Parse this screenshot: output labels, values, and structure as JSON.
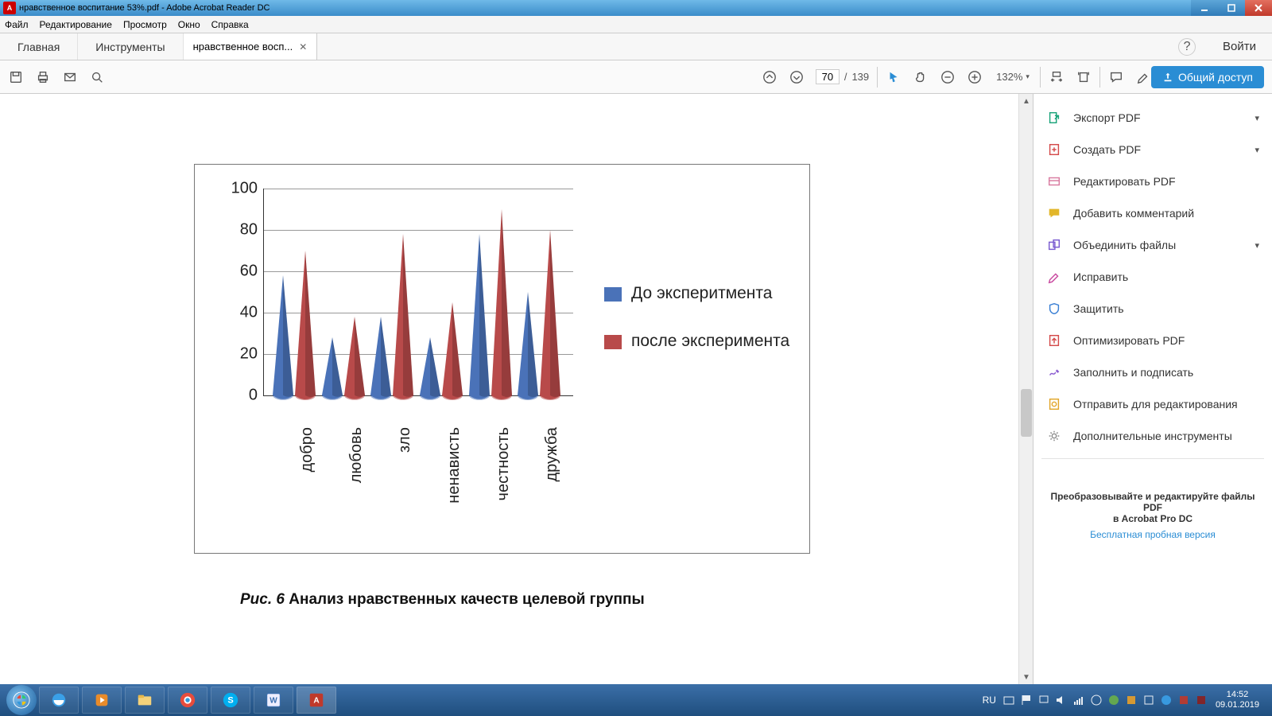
{
  "window": {
    "title": "нравственное воспитание 53%.pdf - Adobe Acrobat Reader DC"
  },
  "menubar": [
    "Файл",
    "Редактирование",
    "Просмотр",
    "Окно",
    "Справка"
  ],
  "tabs": {
    "home": "Главная",
    "tools": "Инструменты",
    "doc": "нравственное восп...",
    "signin": "Войти"
  },
  "toolbar": {
    "page_current": "70",
    "page_sep": "/",
    "page_total": "139",
    "zoom": "132%"
  },
  "share_btn": "Общий доступ",
  "sidepanel": {
    "items": [
      {
        "label": "Экспорт PDF",
        "expand": true,
        "color": "#1aa37a",
        "icon": "export"
      },
      {
        "label": "Создать PDF",
        "expand": true,
        "color": "#d44a4a",
        "icon": "create"
      },
      {
        "label": "Редактировать PDF",
        "expand": false,
        "color": "#d97ba0",
        "icon": "edit"
      },
      {
        "label": "Добавить комментарий",
        "expand": false,
        "color": "#e2b62a",
        "icon": "comment"
      },
      {
        "label": "Объединить файлы",
        "expand": true,
        "color": "#7a5bd0",
        "icon": "combine"
      },
      {
        "label": "Исправить",
        "expand": false,
        "color": "#c94aa0",
        "icon": "redact"
      },
      {
        "label": "Защитить",
        "expand": false,
        "color": "#3a7fd4",
        "icon": "protect"
      },
      {
        "label": "Оптимизировать PDF",
        "expand": false,
        "color": "#d44a4a",
        "icon": "optimize"
      },
      {
        "label": "Заполнить и подписать",
        "expand": false,
        "color": "#8a5bd0",
        "icon": "sign"
      },
      {
        "label": "Отправить для редактирования",
        "expand": false,
        "color": "#e2a62a",
        "icon": "send"
      },
      {
        "label": "Дополнительные инструменты",
        "expand": false,
        "color": "#888",
        "icon": "more"
      }
    ],
    "promo1": "Преобразовывайте и редактируйте файлы PDF",
    "promo2": "в Acrobat Pro DC",
    "promo_link": "Бесплатная пробная версия"
  },
  "caption": {
    "fig": "Рис. 6",
    "text": "  Анализ нравственных качеств целевой группы"
  },
  "legend": {
    "s1": "До эксперитмента",
    "s2": "после эксперимента"
  },
  "chart_data": {
    "type": "bar",
    "categories": [
      "добро",
      "любовь",
      "зло",
      "ненависть",
      "честность",
      "дружба"
    ],
    "series": [
      {
        "name": "До эксперитмента",
        "color": "#4a72b8",
        "values": [
          58,
          28,
          38,
          28,
          78,
          50
        ]
      },
      {
        "name": "после эксперимента",
        "color": "#b84a4a",
        "values": [
          70,
          38,
          78,
          45,
          90,
          80
        ]
      }
    ],
    "ylim": [
      0,
      100
    ],
    "yticks": [
      0,
      20,
      40,
      60,
      80,
      100
    ]
  },
  "taskbar": {
    "lang": "RU",
    "time": "14:52",
    "date": "09.01.2019"
  }
}
